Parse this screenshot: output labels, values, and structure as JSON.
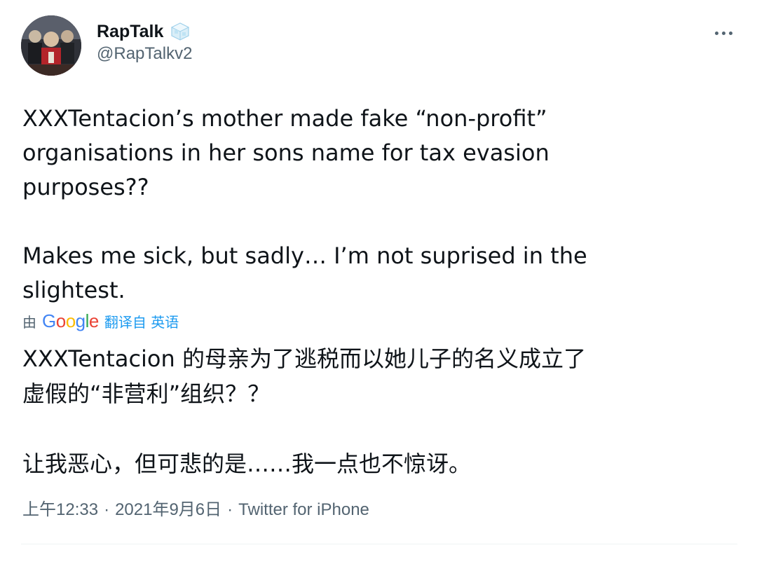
{
  "tweet": {
    "author": {
      "display_name": "RapTalk",
      "handle": "@RapTalkv2",
      "badge_icon": "ice-cube-icon",
      "avatar_icon": "avatar"
    },
    "more_icon": "more-dots-icon",
    "text": "XXXTentacion’s mother made fake “non-profit”\norganisations in her sons name for tax evasion\npurposes??\n\nMakes me sick, but sadly… I’m not suprised in the\nslightest.",
    "translation": {
      "prefix": "由",
      "provider": "Google",
      "action": "翻译自 英语",
      "text": "XXXTentacion 的母亲为了逃税而以她儿子的名义成立了\n虚假的“非营利”组织？？\n\n让我恶心，但可悲的是……我一点也不惊讶。"
    },
    "meta": {
      "time": "上午12:33",
      "date": "2021年9月6日",
      "separator": "·",
      "source": "Twitter for iPhone"
    },
    "colors": {
      "text_primary": "#0f1419",
      "text_secondary": "#536471",
      "link": "#1d9bf0",
      "divider": "#eff3f4"
    }
  }
}
